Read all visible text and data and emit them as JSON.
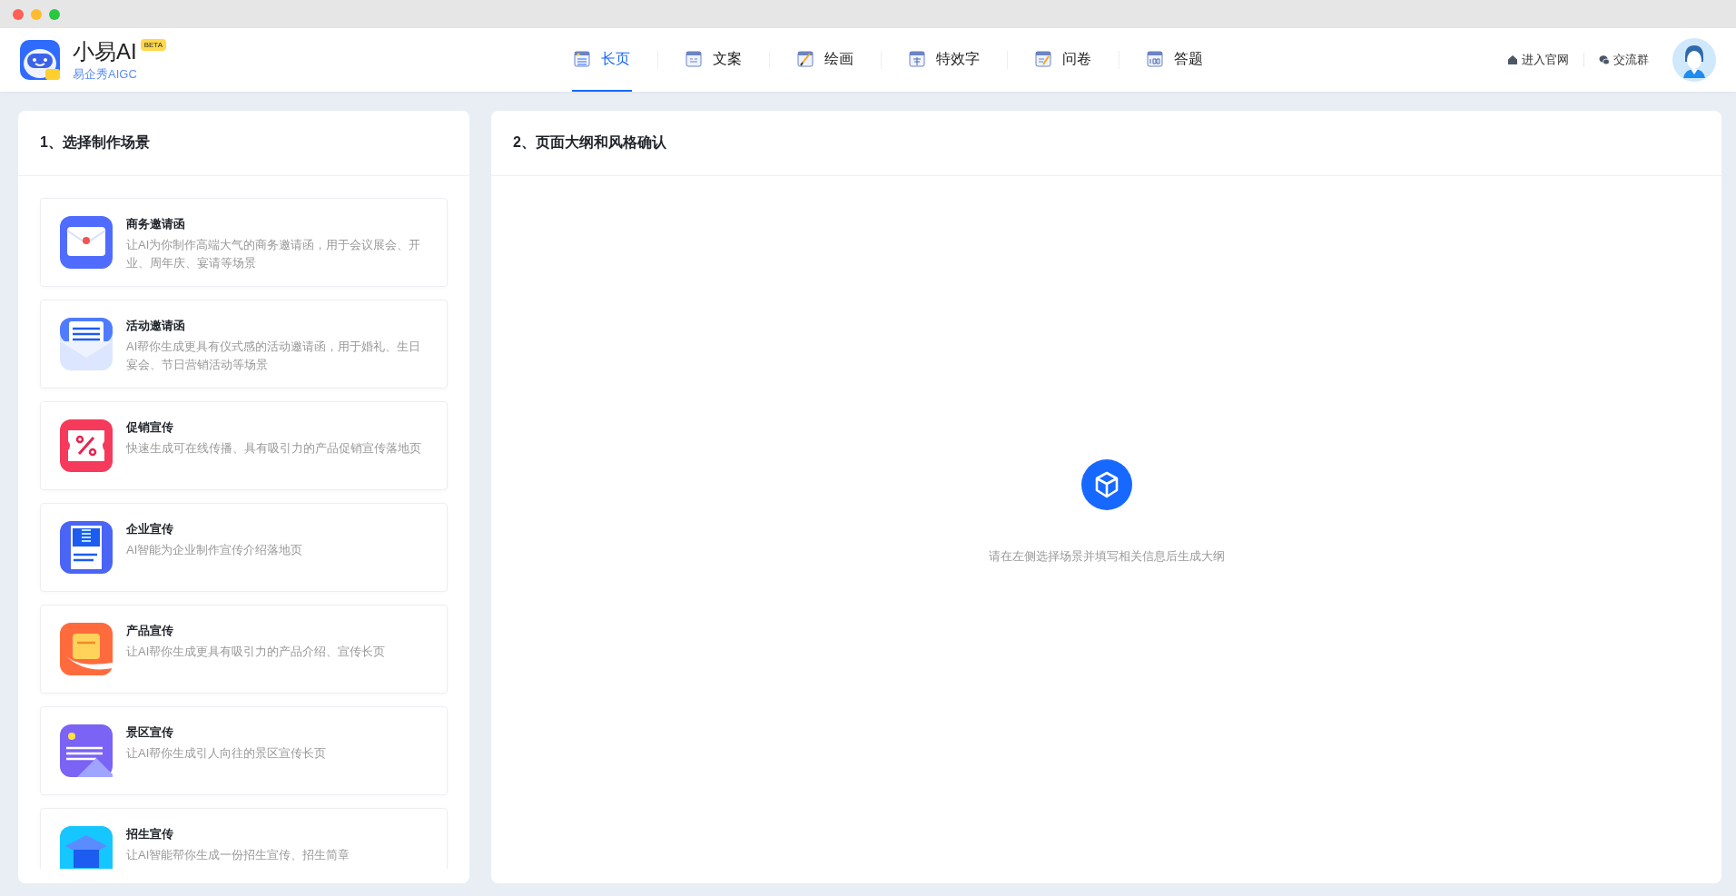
{
  "brand": {
    "name": "小易AI",
    "badge": "BETA",
    "subtitle": "易企秀AIGC"
  },
  "tabs": [
    {
      "label": "长页",
      "kind": "page",
      "selected": true
    },
    {
      "label": "文案",
      "kind": "copy",
      "selected": false
    },
    {
      "label": "绘画",
      "kind": "paint",
      "selected": false
    },
    {
      "label": "特效字",
      "kind": "font",
      "selected": false
    },
    {
      "label": "问卷",
      "kind": "survey",
      "selected": false
    },
    {
      "label": "答题",
      "kind": "quiz",
      "selected": false
    }
  ],
  "header_links": [
    {
      "label": "进入官网",
      "kind": "home"
    },
    {
      "label": "交流群",
      "kind": "chat"
    }
  ],
  "left_panel": {
    "title": "1、选择制作场景",
    "scenes": [
      {
        "title": "商务邀请函",
        "description": "让AI为你制作高端大气的商务邀请函，用于会议展会、开业、周年庆、宴请等场景",
        "kind": "envelope"
      },
      {
        "title": "活动邀请函",
        "description": "AI帮你生成更具有仪式感的活动邀请函，用于婚礼、生日宴会、节日营销活动等场景",
        "kind": "letter"
      },
      {
        "title": "促销宣传",
        "description": "快速生成可在线传播、具有吸引力的产品促销宣传落地页",
        "kind": "coupon"
      },
      {
        "title": "企业宣传",
        "description": "AI智能为企业制作宣传介绍落地页",
        "kind": "building"
      },
      {
        "title": "产品宣传",
        "description": "让AI帮你生成更具有吸引力的产品介绍、宣传长页",
        "kind": "product"
      },
      {
        "title": "景区宣传",
        "description": "让AI帮你生成引人向往的景区宣传长页",
        "kind": "scenery"
      },
      {
        "title": "招生宣传",
        "description": "让AI智能帮你生成一份招生宣传、招生简章",
        "kind": "graduation"
      }
    ]
  },
  "right_panel": {
    "title": "2、页面大纲和风格确认",
    "empty_message": "请在左侧选择场景并填写相关信息后生成大纲"
  }
}
